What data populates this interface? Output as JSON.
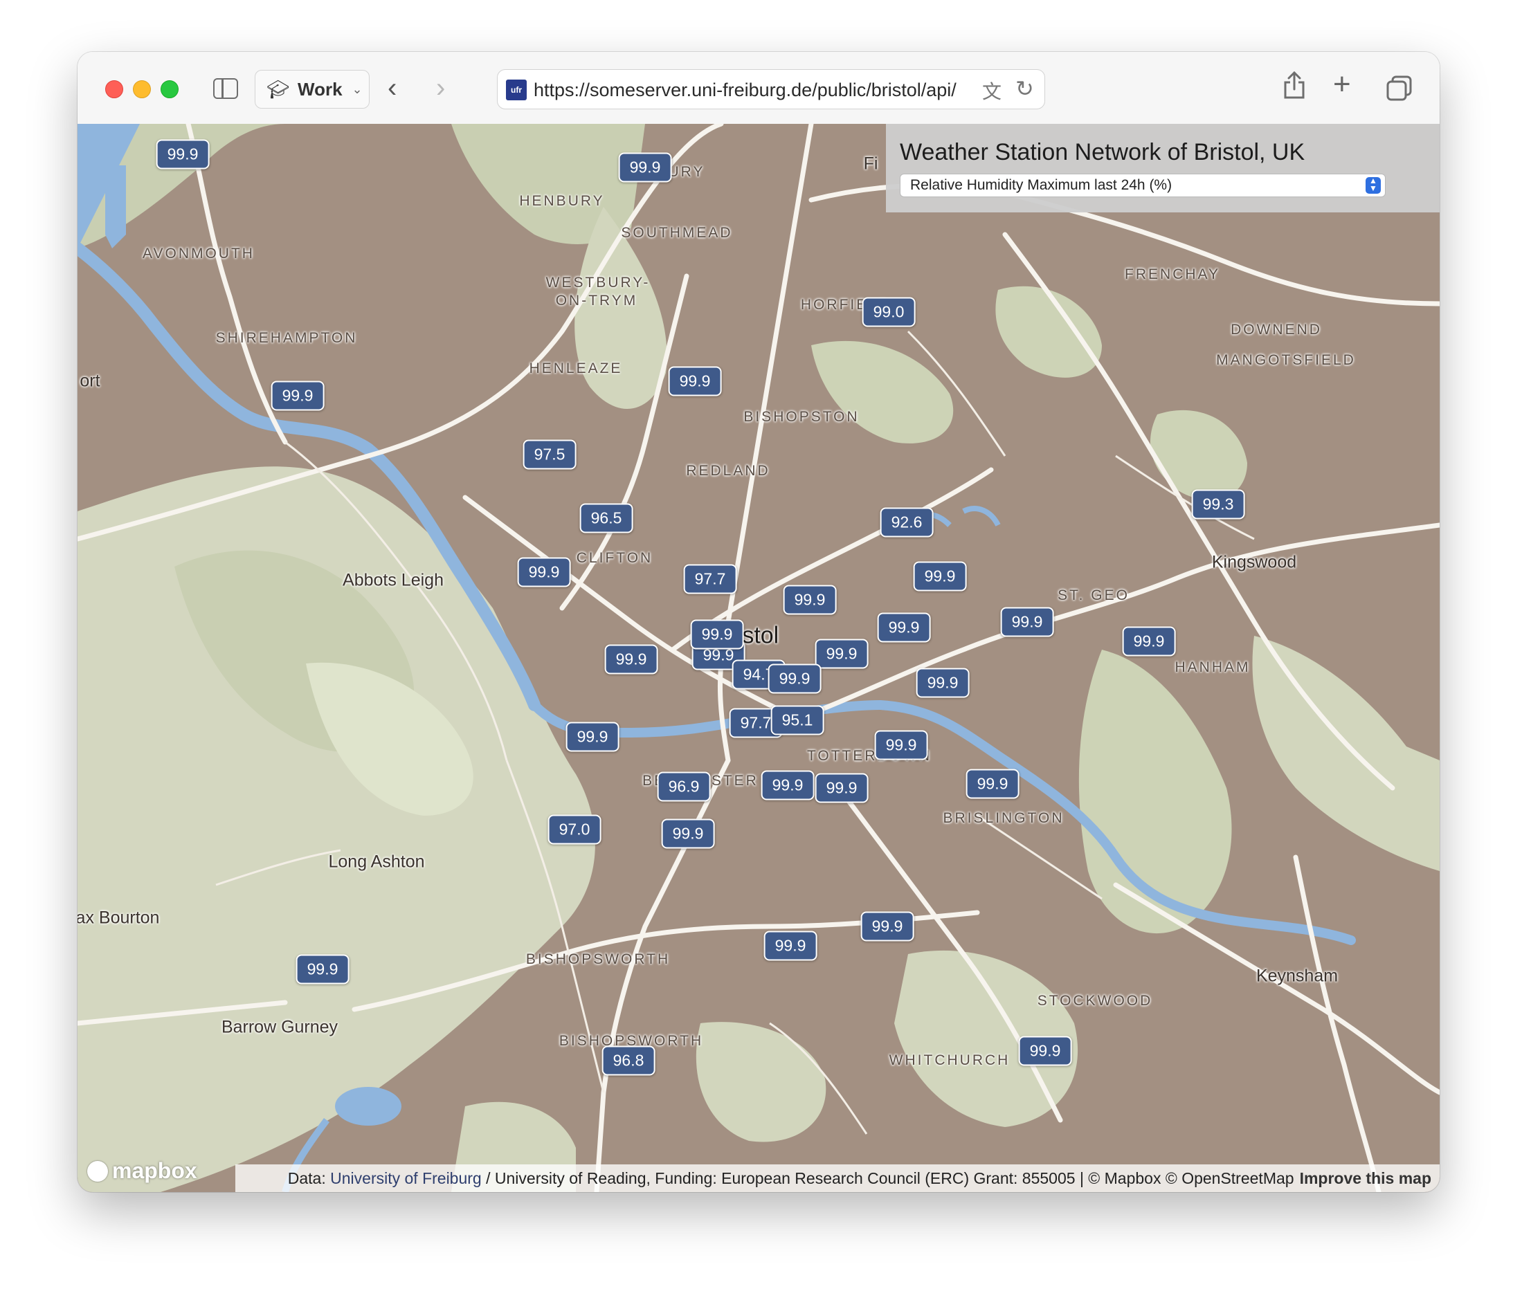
{
  "browser": {
    "profile_label": "Work",
    "url": "https://someserver.uni-freiburg.de/public/bristol/api/",
    "favicon_text": "ufr"
  },
  "panel": {
    "title": "Weather Station Network of Bristol, UK",
    "selected_variable": "Relative Humidity Maximum last 24h (%)"
  },
  "places": {
    "henbury": "HENBURY",
    "southmead": "SOUTHMEAD",
    "avonmouth": "AVONMOUTH",
    "westbury1": "WESTBURY-",
    "westbury2": "ON-TRYM",
    "horfield": "HORFIELD",
    "frenchay": "FRENCHAY",
    "shirehampton": "SHIREHAMPTON",
    "downend": "DOWNEND",
    "mangotsfield": "MANGOTSFIELD",
    "henleaze": "HENLEAZE",
    "bishopston": "BISHOPSTON",
    "redland": "REDLAND",
    "clifton": "CLIFTON",
    "kingswood": "Kingswood",
    "abbots_leigh": "Abbots Leigh",
    "st_george": "ST. GEO",
    "bristol": "Bristol",
    "hanham": "HANHAM",
    "totterdown": "TOTTERDOWN",
    "bedminster": "BEDMINSTER",
    "brislington": "BRISLINGTON",
    "long_ashton": "Long Ashton",
    "flax_bourton": "ax Bourton",
    "bishopsworth": "BISHOPSWORTH",
    "bishopsworth2": "BISHOPSWORTH",
    "keynsham": "Keynsham",
    "stockwood": "STOCKWOOD",
    "barrow_gurney": "Barrow Gurney",
    "whitchurch": "WHITCHURCH",
    "port": "ort",
    "filton": "Fi",
    "bury": "URY"
  },
  "stations": [
    {
      "value": "99.9"
    },
    {
      "value": "99.9"
    },
    {
      "value": "99.0"
    },
    {
      "value": "99.9"
    },
    {
      "value": "99.9"
    },
    {
      "value": "97.5"
    },
    {
      "value": "96.5"
    },
    {
      "value": "92.6"
    },
    {
      "value": "99.3"
    },
    {
      "value": "99.9"
    },
    {
      "value": "97.7"
    },
    {
      "value": "99.9"
    },
    {
      "value": "99.9"
    },
    {
      "value": "99.9"
    },
    {
      "value": "99.9"
    },
    {
      "value": "99.9"
    },
    {
      "value": "99.9"
    },
    {
      "value": "99.9"
    },
    {
      "value": "99.9"
    },
    {
      "value": "99.9"
    },
    {
      "value": "94.7"
    },
    {
      "value": "99.9"
    },
    {
      "value": "99.9"
    },
    {
      "value": "97.7"
    },
    {
      "value": "95.1"
    },
    {
      "value": "99.9"
    },
    {
      "value": "99.9"
    },
    {
      "value": "96.9"
    },
    {
      "value": "99.9"
    },
    {
      "value": "99.9"
    },
    {
      "value": "97.0"
    },
    {
      "value": "99.9"
    },
    {
      "value": "99.9"
    },
    {
      "value": "99.9"
    },
    {
      "value": "99.9"
    },
    {
      "value": "99.9"
    },
    {
      "value": "96.8"
    }
  ],
  "attribution": {
    "data_prefix": "Data:",
    "university_freiburg": "University of Freiburg",
    "rest": "/ University of Reading, Funding: European Research Council (ERC) Grant: 855005 | © Mapbox © OpenStreetMap",
    "improve": "Improve this map",
    "mapbox_logo": "mapbox"
  },
  "colors": {
    "marker_bg": "#3f5a8a",
    "urban": "#a39082",
    "green": "#d2d6bd",
    "water": "#8fb5dd"
  },
  "icons": {
    "sidebar": "sidebar-icon",
    "profile": "graduation-cap-icon",
    "back": "chevron-left-icon",
    "forward": "chevron-right-icon",
    "translate": "translate-icon",
    "reload": "reload-icon",
    "share": "share-icon",
    "new_tab": "plus-icon",
    "tabs": "tab-overview-icon"
  }
}
